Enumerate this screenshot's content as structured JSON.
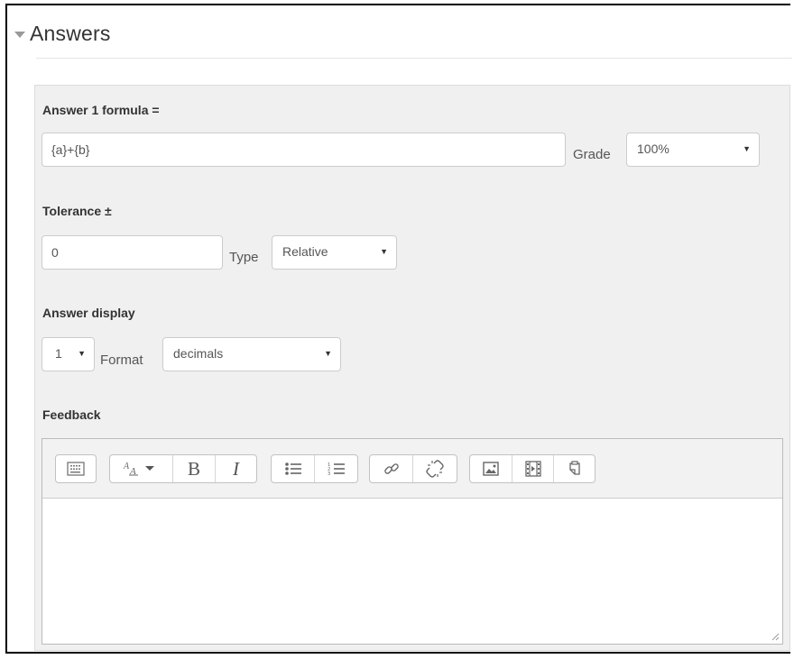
{
  "section": {
    "title": "Answers"
  },
  "answer": {
    "formula_label": "Answer 1 formula =",
    "formula_value": "{a}+{b}",
    "grade_label": "Grade",
    "grade_value": "100%"
  },
  "tolerance": {
    "label": "Tolerance ±",
    "value": "0",
    "type_label": "Type",
    "type_value": "Relative"
  },
  "display": {
    "label": "Answer display",
    "digits_value": "1",
    "format_label": "Format",
    "format_value": "decimals"
  },
  "feedback": {
    "label": "Feedback",
    "toolbar_groups": [
      [
        "toolbar-toggle-icon"
      ],
      [
        "font-style-dropdown-icon",
        "bold-icon",
        "italic-icon"
      ],
      [
        "unordered-list-icon",
        "ordered-list-icon"
      ],
      [
        "link-icon",
        "unlink-icon"
      ],
      [
        "image-icon",
        "media-icon",
        "paste-icon"
      ]
    ],
    "bold_glyph": "B",
    "italic_glyph": "I",
    "content": ""
  }
}
